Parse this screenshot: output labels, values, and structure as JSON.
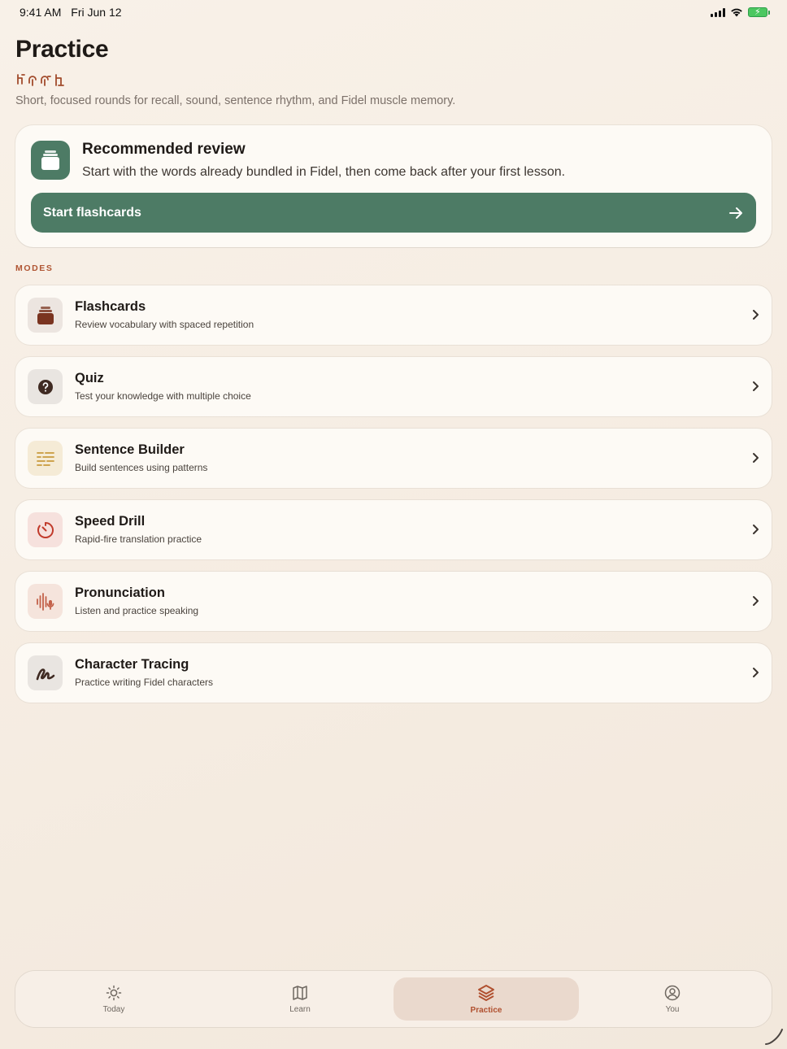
{
  "status_bar": {
    "time": "9:41 AM",
    "date": "Fri Jun 12"
  },
  "header": {
    "title": "Practice",
    "amharic": "ልምምድ",
    "subtitle": "Short, focused rounds for recall, sound, sentence rhythm, and Fidel muscle memory."
  },
  "recommended": {
    "title": "Recommended review",
    "description": "Start with the words already bundled in Fidel, then come back after your first lesson.",
    "button_label": "Start flashcards",
    "icon": "flashcard-stack-icon"
  },
  "modes_label": "MODES",
  "modes": [
    {
      "title": "Flashcards",
      "description": "Review vocabulary with spaced repetition",
      "icon": "flashcard-stack-icon",
      "icon_bg": "#ece5e0",
      "icon_color": "#7a3420"
    },
    {
      "title": "Quiz",
      "description": "Test your knowledge with multiple choice",
      "icon": "question-circle-icon",
      "icon_bg": "#e9e5e1",
      "icon_color": "#3f2a22"
    },
    {
      "title": "Sentence Builder",
      "description": "Build sentences using patterns",
      "icon": "text-lines-icon",
      "icon_bg": "#f5ebd6",
      "icon_color": "#c99a3c"
    },
    {
      "title": "Speed Drill",
      "description": "Rapid-fire translation practice",
      "icon": "timer-icon",
      "icon_bg": "#f6e1dd",
      "icon_color": "#c13b2c"
    },
    {
      "title": "Pronunciation",
      "description": "Listen and practice speaking",
      "icon": "waveform-mic-icon",
      "icon_bg": "#f5e4dc",
      "icon_color": "#c3614a"
    },
    {
      "title": "Character Tracing",
      "description": "Practice writing Fidel characters",
      "icon": "scribble-icon",
      "icon_bg": "#e9e5e1",
      "icon_color": "#3f2a22"
    }
  ],
  "tabs": [
    {
      "label": "Today",
      "icon": "sun-icon",
      "active": false
    },
    {
      "label": "Learn",
      "icon": "map-icon",
      "active": false
    },
    {
      "label": "Practice",
      "icon": "layers-icon",
      "active": true
    },
    {
      "label": "You",
      "icon": "person-circle-icon",
      "active": false
    }
  ],
  "colors": {
    "accent_green": "#4d7b65",
    "accent_rust": "#b05533",
    "background": "#f6ede3"
  }
}
